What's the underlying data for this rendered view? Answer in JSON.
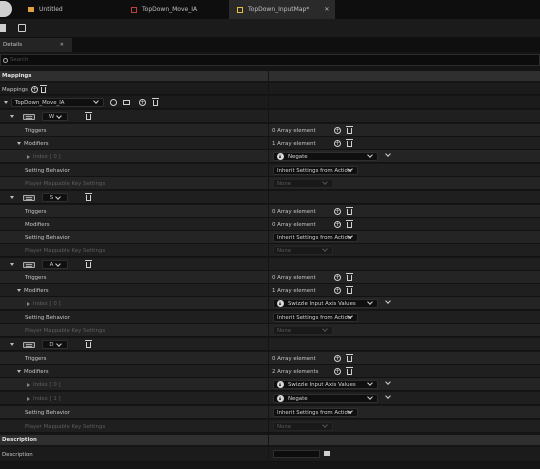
{
  "tabs": [
    {
      "label": "Untitled"
    },
    {
      "label": "TopDown_Move_IA"
    },
    {
      "label": "TopDown_InputMap*"
    }
  ],
  "details": {
    "tab_label": "Details",
    "search_placeholder": "Search",
    "mappings_header": "Mappings",
    "mappings_label": "Mappings",
    "context_value": "TopDown_Move_IA",
    "description_header": "Description",
    "description_label": "Description"
  },
  "labels": {
    "triggers": "Triggers",
    "modifiers": "Modifiers",
    "setting_behavior": "Setting Behavior",
    "player_mappable": "Player Mappable Key Settings",
    "index0": "Index [ 0 ]",
    "index0b": "Index [ 0 ]",
    "index1": "Index [ 1 ]",
    "zero_elements": "0 Array element",
    "one_element": "1 Array element",
    "two_elements": "2 Array elements",
    "inherit": "Inherit Settings from Action",
    "none": "None",
    "negate": "Negate",
    "swizzle": "Swizzle Input Axis Values"
  },
  "keys": [
    {
      "key": "W"
    },
    {
      "key": "S"
    },
    {
      "key": "A"
    },
    {
      "key": "D"
    }
  ]
}
